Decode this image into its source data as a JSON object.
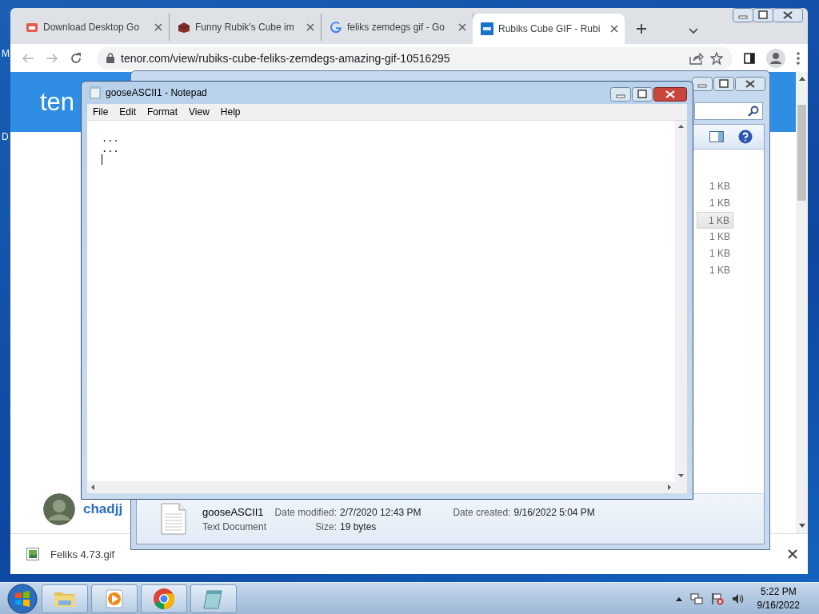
{
  "desktop": {
    "labels": [
      "M",
      "D"
    ]
  },
  "browser": {
    "tabs": [
      {
        "title": "Download Desktop Go",
        "selected": false
      },
      {
        "title": "Funny Rubik's Cube im",
        "selected": false
      },
      {
        "title": "feliks zemdegs gif - Go",
        "selected": false
      },
      {
        "title": "Rubiks Cube GIF - Rubi",
        "selected": true
      }
    ],
    "address": "tenor.com/view/rubiks-cube-feliks-zemdegs-amazing-gif-10516295",
    "page": {
      "logo": "ten",
      "user": "chadjj"
    },
    "downloads": [
      {
        "name": "Feliks 4.73.gif"
      }
    ]
  },
  "explorer": {
    "sizes": [
      {
        "text": "1 KB",
        "selected": false
      },
      {
        "text": "1 KB",
        "selected": false
      },
      {
        "text": "1 KB",
        "selected": true
      },
      {
        "text": "1 KB",
        "selected": false
      },
      {
        "text": "1 KB",
        "selected": false
      },
      {
        "text": "1 KB",
        "selected": false
      }
    ],
    "details": {
      "name": "gooseASCII1",
      "type": "Text Document",
      "modified_label": "Date modified:",
      "modified": "2/7/2020 12:43 PM",
      "created_label": "Date created:",
      "created": "9/16/2022 5:04 PM",
      "size_label": "Size:",
      "size": "19 bytes"
    }
  },
  "notepad": {
    "title": "gooseASCII1 - Notepad",
    "menu": [
      "File",
      "Edit",
      "Format",
      "View",
      "Help"
    ],
    "lines": [
      "...",
      "..."
    ]
  },
  "taskbar": {
    "apps": [
      {
        "kind": "explorer"
      },
      {
        "kind": "media"
      },
      {
        "kind": "chrome"
      },
      {
        "kind": "notepad"
      }
    ],
    "clock": {
      "time": "5:22 PM",
      "date": "9/16/2022"
    }
  }
}
